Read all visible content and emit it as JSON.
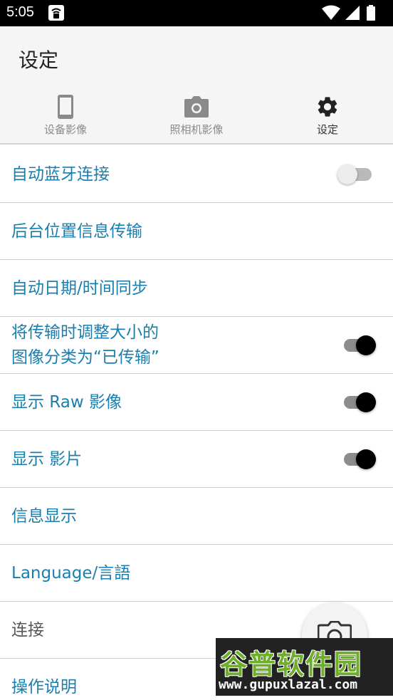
{
  "status_bar": {
    "time": "5:05"
  },
  "header": {
    "title": "设定"
  },
  "tabs": [
    {
      "label": "设备影像",
      "icon": "smartphone-icon",
      "active": false
    },
    {
      "label": "照相机影像",
      "icon": "camera-icon",
      "active": false
    },
    {
      "label": "设定",
      "icon": "gear-icon",
      "active": true
    }
  ],
  "settings": {
    "auto_bluetooth": {
      "label": "自动蓝牙连接",
      "toggle": "off"
    },
    "background_location": {
      "label": "后台位置信息传输"
    },
    "auto_datetime": {
      "label": "自动日期/时间同步"
    },
    "resize_transfer": {
      "line1": "将传输时调整大小的",
      "line2": "图像分类为“已传输”",
      "toggle": "on"
    },
    "show_raw": {
      "label": "显示 Raw 影像",
      "toggle": "on"
    },
    "show_movie": {
      "label": "显示 影片",
      "toggle": "on"
    },
    "info_display": {
      "label": "信息显示"
    },
    "language": {
      "label": "Language/言語"
    },
    "connection": {
      "label": "连接"
    },
    "instructions": {
      "label": "操作说明"
    }
  },
  "watermark": {
    "title": "谷普软件园",
    "url": "www.gupuxlazal.com"
  },
  "colors": {
    "accent": "#1a7fae",
    "header_bg": "#f5f5f5",
    "status_bar_bg": "#000000"
  }
}
